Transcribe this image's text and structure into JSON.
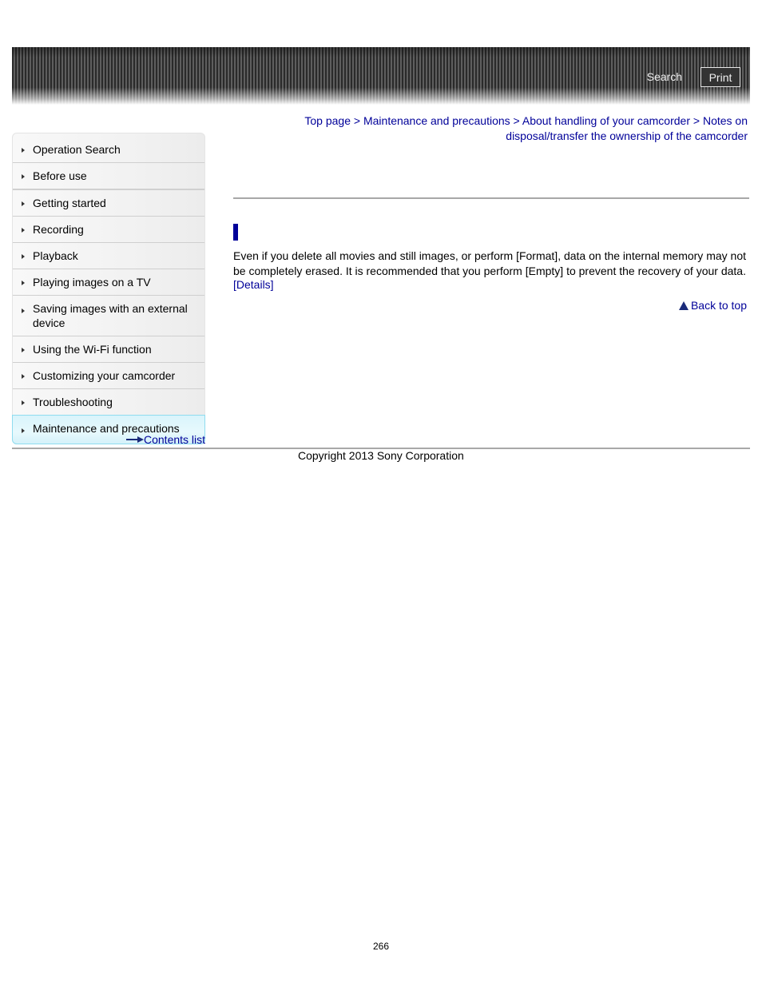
{
  "header": {
    "search_label": "Search",
    "print_label": "Print"
  },
  "breadcrumb": {
    "items": [
      "Top page",
      "Maintenance and precautions",
      "About handling of your camcorder",
      "Notes on disposal/transfer the ownership of the camcorder"
    ],
    "separator": ">"
  },
  "sidebar": {
    "items": [
      {
        "label": "Operation Search"
      },
      {
        "label": "Before use"
      },
      {
        "label": "Getting started"
      },
      {
        "label": "Recording"
      },
      {
        "label": "Playback"
      },
      {
        "label": "Playing images on a TV"
      },
      {
        "label": "Saving images with an external device"
      },
      {
        "label": "Using the Wi-Fi function"
      },
      {
        "label": "Customizing your camcorder"
      },
      {
        "label": "Troubleshooting"
      },
      {
        "label": "Maintenance and precautions",
        "active": true
      }
    ],
    "contents_list_label": "Contents list"
  },
  "main": {
    "heading": "",
    "body": "Even if you delete all movies and still images, or perform [Format], data on the internal memory may not be completely erased. It is recommended that you perform [Empty] to prevent the recovery of your data.",
    "details_link": "[Details]",
    "back_to_top": "Back to top"
  },
  "footer": {
    "copyright": "Copyright 2013 Sony Corporation",
    "page_number": "266"
  },
  "colors": {
    "link": "#000099",
    "active_nav_bg": "#dff6fc",
    "active_nav_border": "#8fdcef"
  }
}
